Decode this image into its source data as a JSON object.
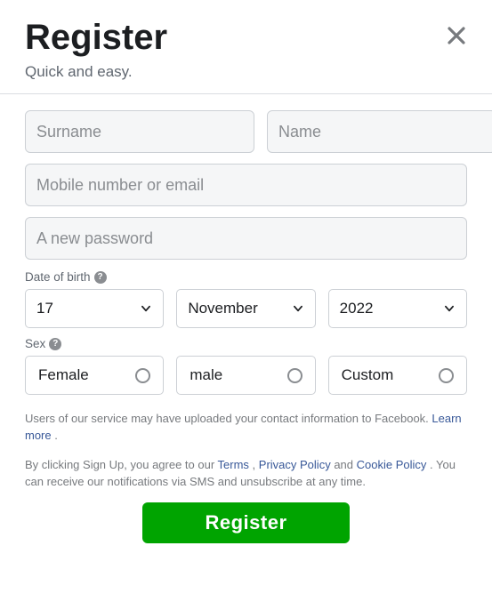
{
  "header": {
    "title": "Register",
    "subtitle": "Quick and easy."
  },
  "inputs": {
    "surname_placeholder": "Surname",
    "name_placeholder": "Name",
    "contact_placeholder": "Mobile number or email",
    "password_placeholder": "A new password"
  },
  "dob": {
    "label": "Date of birth",
    "day": "17",
    "month": "November",
    "year": "2022"
  },
  "sex": {
    "label": "Sex",
    "options": {
      "female": "Female",
      "male": "male",
      "custom": "Custom"
    }
  },
  "legal": {
    "upload_text": "Users of our service may have uploaded your contact information to Facebook. ",
    "learn_more": "Learn more",
    "agree_prefix": "By clicking Sign Up, you agree to our ",
    "terms": "Terms",
    "privacy": "Privacy Policy",
    "cookie": "Cookie Policy",
    "agree_and": " and ",
    "agree_sep": " , ",
    "agree_suffix": " . You can receive our notifications via SMS and unsubscribe at any time."
  },
  "submit_label": "Register"
}
